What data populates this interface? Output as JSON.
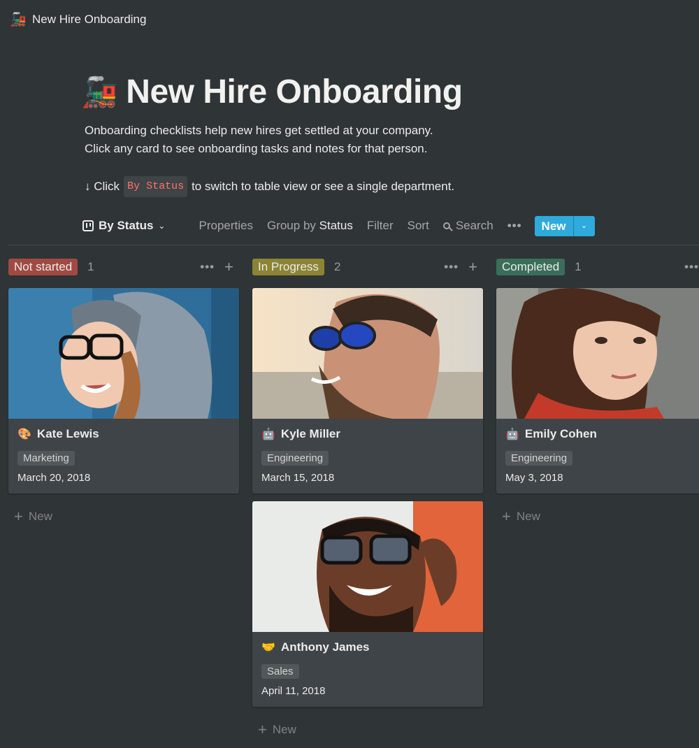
{
  "breadcrumb": {
    "emoji": "🚂",
    "label": "New Hire Onboarding"
  },
  "page": {
    "emoji": "🚂",
    "title": "New Hire Onboarding",
    "description_line1": "Onboarding checklists help new hires get settled at your company.",
    "description_line2": "Click any card to see onboarding tasks and notes for that person.",
    "hint_prefix": "↓ Click",
    "hint_code": "By Status",
    "hint_suffix": "to switch to table view or see a single department."
  },
  "toolbar": {
    "view_label": "By Status",
    "properties": "Properties",
    "group_by": "Group by",
    "group_by_value": "Status",
    "filter": "Filter",
    "sort": "Sort",
    "search": "Search",
    "more": "•••",
    "new_label": "New",
    "new_dropdown": "⌄"
  },
  "columns": [
    {
      "label": "Not started",
      "color": "#a04a43",
      "count": "1",
      "more": "•••",
      "add": "+",
      "add_new": "New",
      "cards": [
        {
          "emoji": "🎨",
          "name": "Kate Lewis",
          "department": "Marketing",
          "date": "March 20, 2018"
        }
      ]
    },
    {
      "label": "In Progress",
      "color": "#8b8434",
      "count": "2",
      "more": "•••",
      "add": "+",
      "add_new": "New",
      "cards": [
        {
          "emoji": "🤖",
          "name": "Kyle Miller",
          "department": "Engineering",
          "date": "March 15, 2018"
        },
        {
          "emoji": "🤝",
          "name": "Anthony James",
          "department": "Sales",
          "date": "April 11, 2018"
        }
      ]
    },
    {
      "label": "Completed",
      "color": "#3b6e5a",
      "count": "1",
      "more": "•••",
      "add": "+",
      "add_new": "New",
      "cards": [
        {
          "emoji": "🤖",
          "name": "Emily Cohen",
          "department": "Engineering",
          "date": "May 3, 2018"
        }
      ]
    }
  ]
}
